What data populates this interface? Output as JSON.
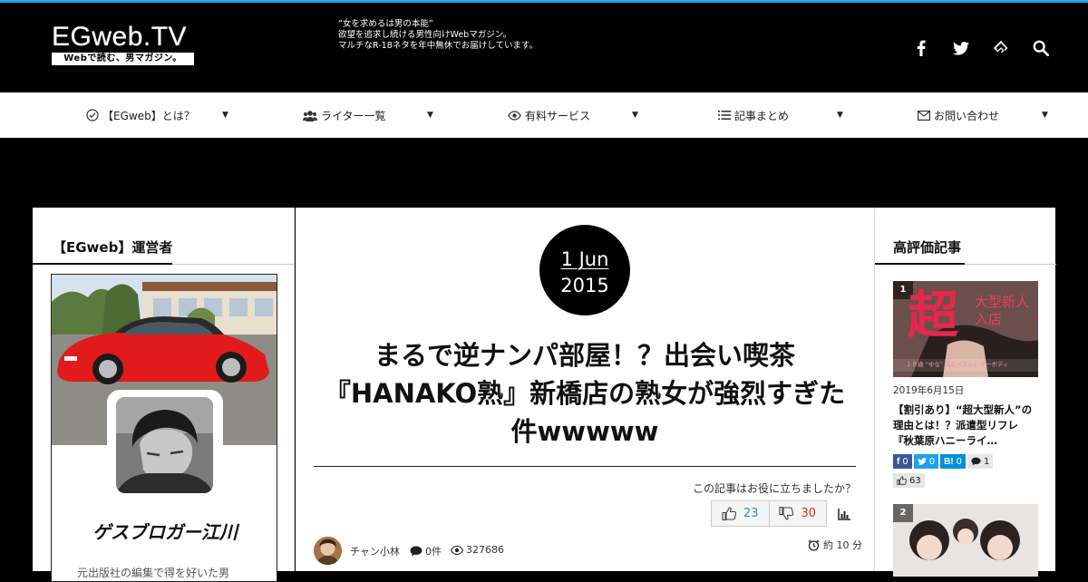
{
  "site": {
    "logo": "EGweb.TV",
    "logo_sub": "Webで読む、男マガジン。",
    "tagline": [
      "“女を求めるは男の本能”",
      "欲望を追求し続ける男性向けWebマガジン。",
      "マルチなR-18ネタを年中無休でお届けしています。"
    ],
    "social_icons": [
      "facebook-icon",
      "twitter-icon",
      "feedly-icon",
      "search-icon"
    ]
  },
  "nav": {
    "items": [
      {
        "label": "【EGweb】とは？",
        "icon": "check-circle-icon",
        "arrow": "▼"
      },
      {
        "label": "ライター一覧",
        "icon": "users-icon",
        "arrow": "▼"
      },
      {
        "label": "有料サービス",
        "icon": "eye-icon",
        "arrow": "▼"
      },
      {
        "label": "記事まとめ",
        "icon": "list-icon",
        "arrow": "▼"
      },
      {
        "label": "お問い合わせ",
        "icon": "mail-icon",
        "arrow": "▼"
      }
    ]
  },
  "sidebar_left": {
    "title": "【EGweb】運営者",
    "profile_name": "ゲスブロガー江川",
    "profile_text": "元出版社の編集で得を好いた男"
  },
  "article": {
    "date_day": "1 Jun",
    "date_year": "2015",
    "title": "まるで逆ナンパ部屋！？出会い喫茶『HANAKO熟』新橋店の熟女が強烈すぎた件wwwww",
    "useful_question": "この記事はお役に立ちましたか？",
    "likes": "23",
    "dislikes": "30",
    "author": "チャン小林",
    "comments": "0件",
    "views": "327686",
    "read_time": "約 10 分"
  },
  "sidebar_right": {
    "title": "高評価記事",
    "cards": [
      {
        "rank": "1",
        "banner_big": "超",
        "banner_text": "大型新人入店",
        "banner_caption": "１９歳 “ゆな” 黒髪×スレンダーボディ",
        "date": "2019年6月15日",
        "title": "【割引あり】“超大型新人”の理由とは！？派遣型リフレ『秋葉原ハニーライ…",
        "fb": "0",
        "tw": "0",
        "hb": "0",
        "comments": "1",
        "likes": "63"
      },
      {
        "rank": "2"
      }
    ]
  },
  "colors": {
    "accent_blue": "#1fa3ec",
    "vote_like": "#2b8fd8",
    "vote_dislike": "#d0352e",
    "facebook": "#3b5998",
    "twitter": "#1da1f2",
    "hatena": "#008fde"
  }
}
